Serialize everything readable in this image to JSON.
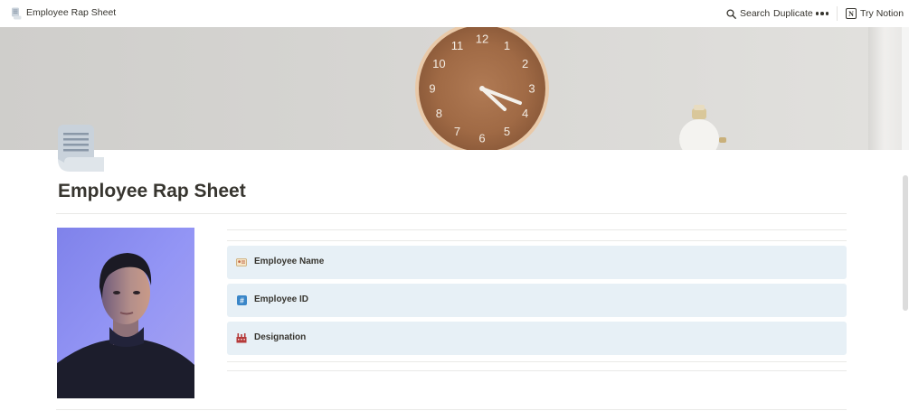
{
  "topbar": {
    "breadcrumb": "Employee Rap Sheet",
    "page_icon": "scroll-icon",
    "search_label": "Search",
    "search_icon": "search-icon",
    "duplicate_label": "Duplicate",
    "more_icon": "more-horizontal-icon",
    "try_label": "Try Notion",
    "notion_logo": "N"
  },
  "cover": {
    "clock_numbers": [
      "12",
      "1",
      "2",
      "3",
      "4",
      "5",
      "6",
      "7",
      "8",
      "9",
      "10",
      "11"
    ]
  },
  "page": {
    "icon": "scroll-icon",
    "title": "Employee Rap Sheet"
  },
  "properties": [
    {
      "label": "Employee Name",
      "icon": "id-card-icon"
    },
    {
      "label": "Employee ID",
      "icon": "hash-icon"
    },
    {
      "label": "Designation",
      "icon": "factory-icon"
    }
  ],
  "colors": {
    "text": "#37352f",
    "property_bg": "#e7f0f6",
    "rule": "#e9e9e7",
    "photo_bg": "#8d8ff0"
  }
}
